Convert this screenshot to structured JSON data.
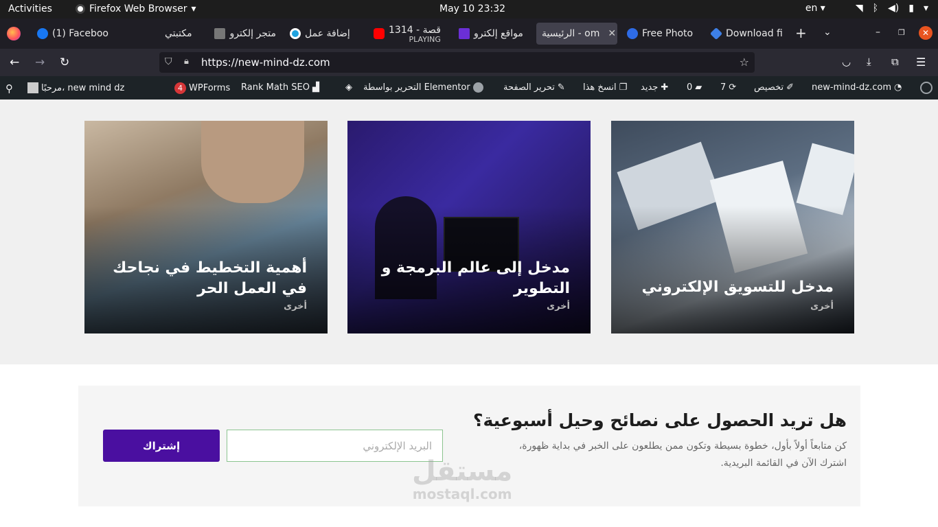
{
  "system_bar": {
    "activities": "Activities",
    "app_name": "Firefox Web Browser",
    "clock": "May 10  23:32",
    "lang": "en"
  },
  "tabs": [
    {
      "label": "(1) Faceboo",
      "icon_color": "#1877f2"
    },
    {
      "label": "مكتبتي",
      "icon_color": ""
    },
    {
      "label": "متجر إلكترو",
      "icon_color": "#777777"
    },
    {
      "label": "إضافة عمل",
      "icon_color": "#1fa3e0"
    },
    {
      "label": "1314 - قصة",
      "sub": "PLAYING",
      "icon_color": "#ff0000"
    },
    {
      "label": "مواقع إلكترو",
      "icon_color": "#6b2fd6"
    },
    {
      "label": "الرئيسية - om",
      "icon_color": ""
    },
    {
      "label": "Free Photo",
      "icon_color": "#2e6be6"
    },
    {
      "label": "Download fi",
      "icon_color": "#3d7fe6"
    }
  ],
  "address_bar": {
    "url": "https://new-mind-dz.com"
  },
  "wp_admin_bar": {
    "site": "new-mind-dz.com",
    "customize": "تخصيص",
    "updates": "7",
    "comments": "0",
    "new": "جديد",
    "copy": "انسخ هذا",
    "edit_page": "تحرير الصفحة",
    "elementor": "التحرير بواسطة Elementor",
    "rankmath": "Rank Math SEO",
    "wpforms": "WPForms",
    "wpforms_badge": "4",
    "greeting": "مرحبًا، new mind dz"
  },
  "cards": [
    {
      "title": "أهمية التخطيط في نجاحك في العمل الحر",
      "category": "أخرى"
    },
    {
      "title": "مدخل إلى عالم البرمجة و التطوير",
      "category": "أخرى"
    },
    {
      "title": "مدخل للتسويق الإلكتروني",
      "category": "أخرى"
    }
  ],
  "newsletter": {
    "title": "هل تريد الحصول على نصائح وحيل أسبوعية؟",
    "description": "كن متابعاً أولاً بأول، خطوة بسيطة وتكون ممن يطلعون على الخبر في بداية ظهورة، اشترك الآن في القائمة البريدية.",
    "email_placeholder": "البريد الإلكتروني",
    "subscribe_label": "إشتراك"
  },
  "watermark": {
    "arabic": "مستقل",
    "latin": "mostaql.com"
  }
}
